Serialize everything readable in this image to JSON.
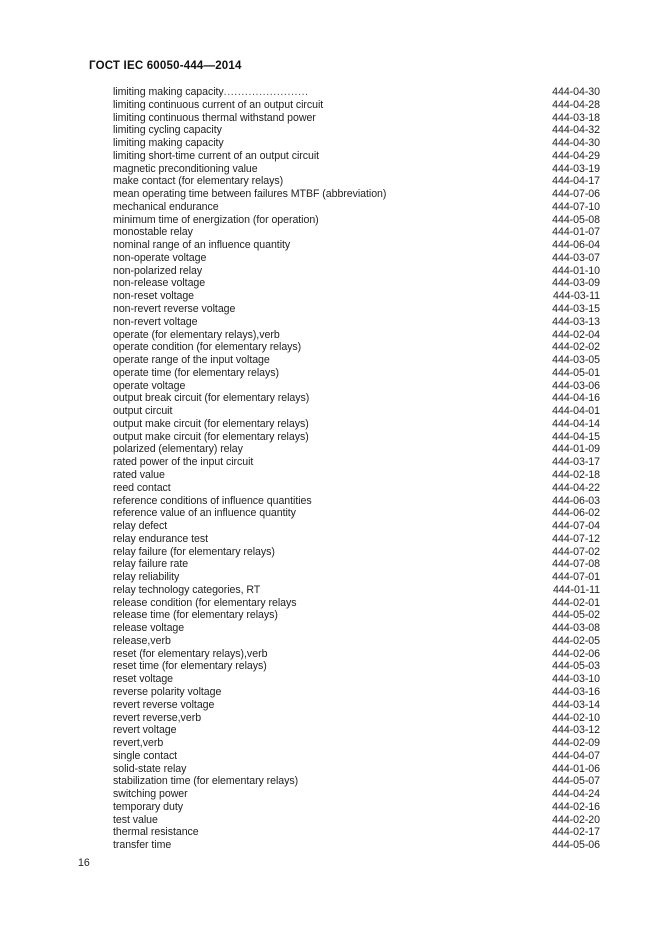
{
  "header": {
    "title": "ГОСТ IEC 60050-444—2014"
  },
  "footer": {
    "page_number": "16"
  },
  "index": {
    "leader_dots": "........................",
    "entries": [
      {
        "term": "limiting making capacity",
        "leader": true,
        "verb": "",
        "code": "444-04-30"
      },
      {
        "term": "limiting continuous current of an output circuit",
        "leader": false,
        "verb": "",
        "code": "444-04-28"
      },
      {
        "term": "limiting continuous thermal withstand power",
        "leader": false,
        "verb": "",
        "code": "444-03-18"
      },
      {
        "term": "limiting cycling capacity",
        "leader": false,
        "verb": "",
        "code": "444-04-32"
      },
      {
        "term": "limiting making capacity",
        "leader": false,
        "verb": "",
        "code": "444-04-30"
      },
      {
        "term": "limiting short-time current of an output circuit",
        "leader": false,
        "verb": "",
        "code": "444-04-29"
      },
      {
        "term": "magnetic preconditioning value",
        "leader": false,
        "verb": "",
        "code": "444-03-19"
      },
      {
        "term": "make contact (for elementary relays)",
        "leader": false,
        "verb": "",
        "code": "444-04-17"
      },
      {
        "term": "mean operating time between failures MTBF (abbreviation)",
        "leader": false,
        "verb": "",
        "code": "444-07-06"
      },
      {
        "term": "mechanical endurance",
        "leader": false,
        "verb": "",
        "code": "444-07-10"
      },
      {
        "term": "minimum time of energization (for operation)",
        "leader": false,
        "verb": "",
        "code": "444-05-08"
      },
      {
        "term": "monostable relay",
        "leader": false,
        "verb": "",
        "code": "444-01-07"
      },
      {
        "term": "nominal range of an influence quantity",
        "leader": false,
        "verb": "",
        "code": "444-06-04"
      },
      {
        "term": "non-operate voltage",
        "leader": false,
        "verb": "",
        "code": "444-03-07"
      },
      {
        "term": "non-polarized relay",
        "leader": false,
        "verb": "",
        "code": "444-01-10"
      },
      {
        "term": "non-release voltage",
        "leader": false,
        "verb": "",
        "code": "444-03-09"
      },
      {
        "term": "non-reset voltage",
        "leader": false,
        "verb": "",
        "code": "444-03-11"
      },
      {
        "term": "non-revert reverse voltage",
        "leader": false,
        "verb": "",
        "code": "444-03-15"
      },
      {
        "term": "non-revert voltage",
        "leader": false,
        "verb": "",
        "code": "444-03-13"
      },
      {
        "term": "operate (for elementary relays), ",
        "leader": false,
        "verb": "verb",
        "code": "444-02-04"
      },
      {
        "term": "operate condition (for elementary relays)",
        "leader": false,
        "verb": "",
        "code": "444-02-02"
      },
      {
        "term": "operate range of the input voltage",
        "leader": false,
        "verb": "",
        "code": "444-03-05"
      },
      {
        "term": "operate time (for elementary relays)",
        "leader": false,
        "verb": "",
        "code": "444-05-01"
      },
      {
        "term": "operate voltage",
        "leader": false,
        "verb": "",
        "code": "444-03-06"
      },
      {
        "term": "output break circuit (for elementary relays)",
        "leader": false,
        "verb": "",
        "code": "444-04-16"
      },
      {
        "term": "output circuit",
        "leader": false,
        "verb": "",
        "code": "444-04-01"
      },
      {
        "term": "output make circuit (for elementary relays)",
        "leader": false,
        "verb": "",
        "code": "444-04-14"
      },
      {
        "term": "output make circuit (for elementary relays)",
        "leader": false,
        "verb": "",
        "code": "444-04-15"
      },
      {
        "term": "polarized (elementary) relay",
        "leader": false,
        "verb": "",
        "code": "444-01-09"
      },
      {
        "term": "rated power of the input circuit",
        "leader": false,
        "verb": "",
        "code": "444-03-17"
      },
      {
        "term": "rated value",
        "leader": false,
        "verb": "",
        "code": "444-02-18"
      },
      {
        "term": "reed contact",
        "leader": false,
        "verb": "",
        "code": "444-04-22"
      },
      {
        "term": "reference conditions of influence quantities",
        "leader": false,
        "verb": "",
        "code": "444-06-03"
      },
      {
        "term": "reference value of an influence quantity",
        "leader": false,
        "verb": "",
        "code": "444-06-02"
      },
      {
        "term": "relay defect",
        "leader": false,
        "verb": "",
        "code": "444-07-04"
      },
      {
        "term": "relay endurance test",
        "leader": false,
        "verb": "",
        "code": "444-07-12"
      },
      {
        "term": "relay failure (for elementary relays)",
        "leader": false,
        "verb": "",
        "code": "444-07-02"
      },
      {
        "term": "relay failure rate",
        "leader": false,
        "verb": "",
        "code": "444-07-08"
      },
      {
        "term": "relay reliability",
        "leader": false,
        "verb": "",
        "code": "444-07-01"
      },
      {
        "term": "relay technology categories, RT",
        "leader": false,
        "verb": "",
        "code": "444-01-11"
      },
      {
        "term": "release condition (for elementary relays",
        "leader": false,
        "verb": "",
        "code": "444-02-01"
      },
      {
        "term": "release time (for elementary relays)",
        "leader": false,
        "verb": "",
        "code": "444-05-02"
      },
      {
        "term": "release voltage",
        "leader": false,
        "verb": "",
        "code": "444-03-08"
      },
      {
        "term": "release, ",
        "leader": false,
        "verb": "verb",
        "code": "444-02-05"
      },
      {
        "term": "reset (for elementary relays), ",
        "leader": false,
        "verb": "verb",
        "code": "444-02-06"
      },
      {
        "term": "reset time (for elementary relays)",
        "leader": false,
        "verb": "",
        "code": "444-05-03"
      },
      {
        "term": "reset voltage",
        "leader": false,
        "verb": "",
        "code": "444-03-10"
      },
      {
        "term": "reverse polarity voltage",
        "leader": false,
        "verb": "",
        "code": "444-03-16"
      },
      {
        "term": "revert reverse voltage",
        "leader": false,
        "verb": "",
        "code": "444-03-14"
      },
      {
        "term": "revert reverse, ",
        "leader": false,
        "verb": "verb",
        "code": "444-02-10"
      },
      {
        "term": "revert voltage",
        "leader": false,
        "verb": "",
        "code": "444-03-12"
      },
      {
        "term": "revert, ",
        "leader": false,
        "verb": "verb",
        "code": "444-02-09"
      },
      {
        "term": "single contact",
        "leader": false,
        "verb": "",
        "code": "444-04-07"
      },
      {
        "term": "solid-state relay",
        "leader": false,
        "verb": "",
        "code": "444-01-06"
      },
      {
        "term": "stabilization time (for elementary relays)",
        "leader": false,
        "verb": "",
        "code": "444-05-07"
      },
      {
        "term": "switching power",
        "leader": false,
        "verb": "",
        "code": "444-04-24"
      },
      {
        "term": "temporary duty",
        "leader": false,
        "verb": "",
        "code": "444-02-16"
      },
      {
        "term": "test value",
        "leader": false,
        "verb": "",
        "code": "444-02-20"
      },
      {
        "term": "thermal resistance",
        "leader": false,
        "verb": "",
        "code": "444-02-17"
      },
      {
        "term": "transfer time",
        "leader": false,
        "verb": "",
        "code": "444-05-06"
      }
    ]
  }
}
